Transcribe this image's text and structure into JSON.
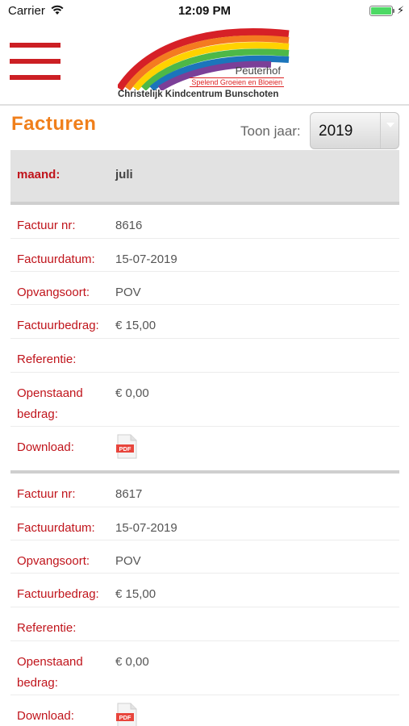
{
  "status_bar": {
    "carrier": "Carrier",
    "time": "12:09 PM",
    "wifi_icon": "wifi-icon",
    "battery_icon": "battery-icon",
    "charging_icon": "charging-bolt-icon",
    "bolt_glyph": "⚡"
  },
  "header": {
    "menu_icon": "hamburger-menu-icon",
    "logo": {
      "brand": "Peuterhof",
      "slogan": "Spelend Groeien en Bloeien",
      "center_name": "Christelijk Kindcentrum Bunschoten"
    }
  },
  "page": {
    "title": "Facturen",
    "year_label": "Toon jaar:",
    "year_value": "2019"
  },
  "month": {
    "label": "maand:",
    "value": "juli"
  },
  "invoices": [
    {
      "nr_label": "Factuur nr:",
      "nr": "8616",
      "date_label": "Factuurdatum:",
      "date": "15-07-2019",
      "type_label": "Opvangsoort:",
      "type": "POV",
      "amount_label": "Factuurbedrag:",
      "amount": "€ 15,00",
      "ref_label": "Referentie:",
      "ref": "",
      "open_label": "Openstaand bedrag:",
      "open": "€ 0,00",
      "download_label": "Download:"
    },
    {
      "nr_label": "Factuur nr:",
      "nr": "8617",
      "date_label": "Factuurdatum:",
      "date": "15-07-2019",
      "type_label": "Opvangsoort:",
      "type": "POV",
      "amount_label": "Factuurbedrag:",
      "amount": "€ 15,00",
      "ref_label": "Referentie:",
      "ref": "",
      "open_label": "Openstaand bedrag:",
      "open": "€ 0,00",
      "download_label": "Download:"
    }
  ],
  "pdf_icon": {
    "label": "PDF",
    "color": "#e8453c"
  },
  "colors": {
    "brand_red": "#cc1f24",
    "title_orange": "#f07f1b",
    "label_red": "#c0141b",
    "month_bar": "#e2e2e2"
  }
}
